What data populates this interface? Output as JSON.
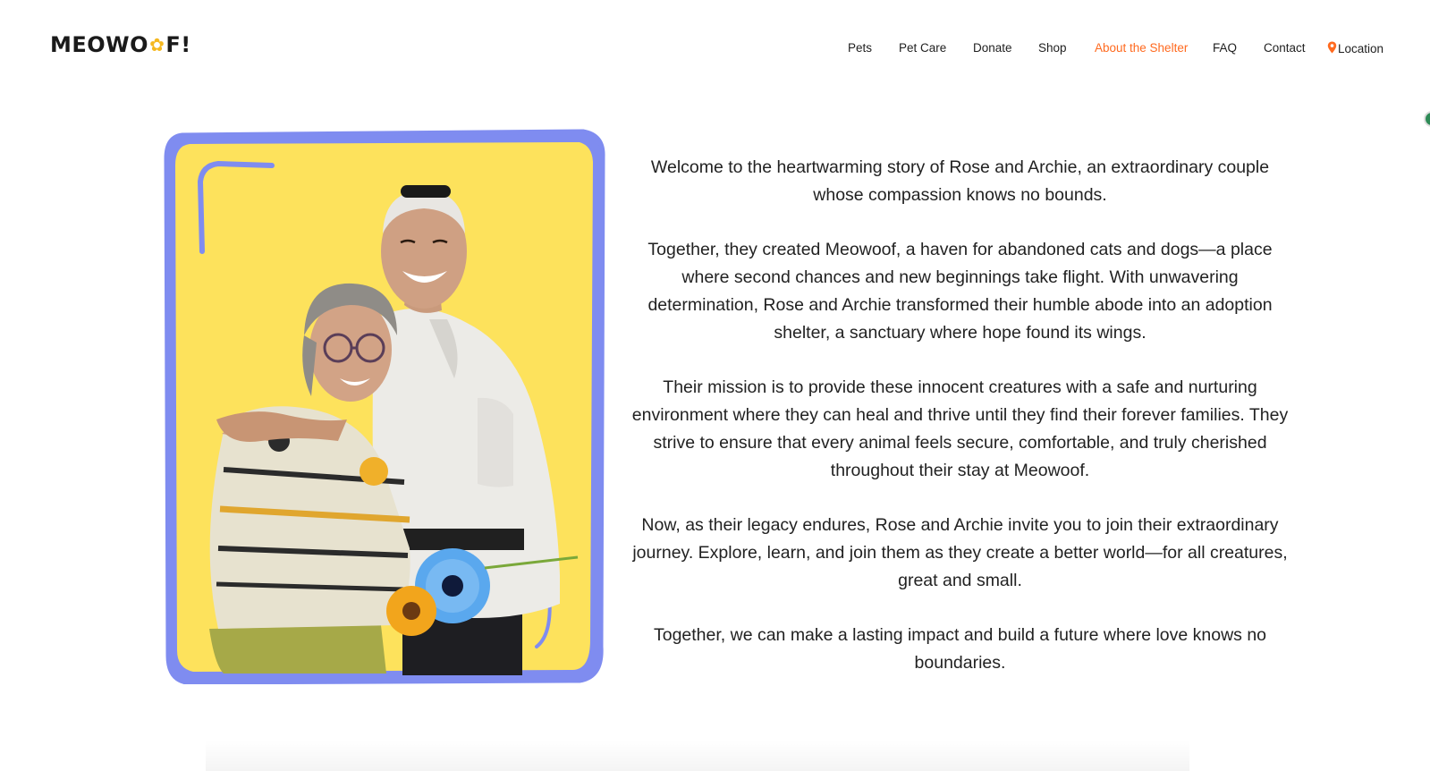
{
  "brand": {
    "name_before": "MEOWO",
    "name_after": "F!"
  },
  "nav": {
    "items": [
      "Pets",
      "Pet Care",
      "Donate",
      "Shop",
      "About the Shelter",
      "FAQ",
      "Contact",
      "Location"
    ],
    "active": "About the Shelter",
    "location_icon": "map-pin-icon"
  },
  "colors": {
    "accent": "#ff6a1f",
    "frame_border": "#7f8cf0",
    "frame_fill": "#fde25c"
  },
  "story": {
    "paragraphs": [
      "Welcome to the heartwarming story of Rose and Archie, an extraordinary couple whose compassion knows no bounds.",
      "Together, they created Meowoof, a haven for abandoned cats and dogs—a place where second chances and new beginnings take flight. With unwavering determination, Rose and Archie transformed their humble abode into an adoption shelter, a sanctuary where hope found its wings.",
      "Their mission is to provide these innocent creatures with a safe and nurturing environment where they can heal and thrive until they find their forever families. They strive to ensure that every animal feels secure, comfortable, and truly cherished throughout their stay at Meowoof.",
      "Now, as their legacy endures, Rose and Archie invite you to join their extraordinary journey. Explore, learn, and join them as they create a better world—for all creatures, great and small.",
      "Together, we can make a lasting impact and build a future where love knows no boundaries."
    ]
  }
}
